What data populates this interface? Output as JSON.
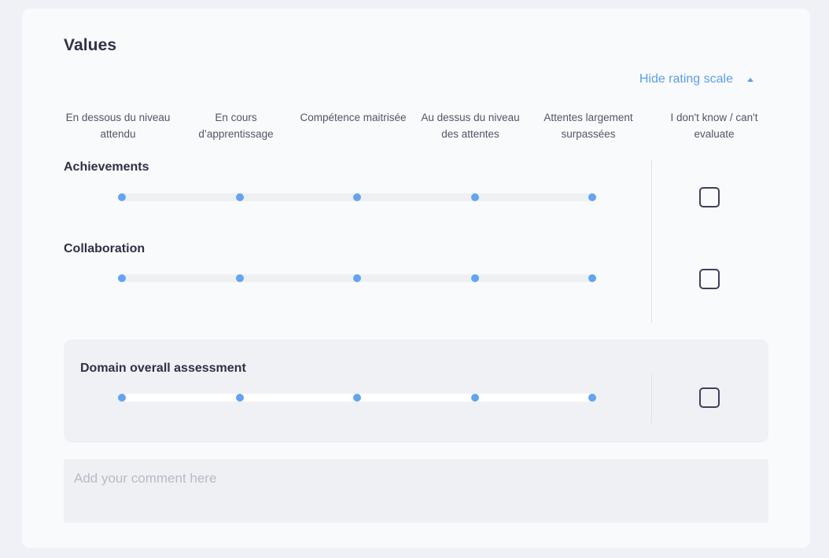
{
  "section": {
    "title": "Values",
    "toggle_label": "Hide rating scale"
  },
  "scale_labels": [
    "En dessous du niveau attendu",
    "En cours d’apprentissage",
    "Compétence maitrisée",
    "Au dessus du niveau des attentes",
    "Attentes largement surpassées",
    "I don't know / can't evaluate"
  ],
  "criteria": [
    {
      "label": "Achievements",
      "selected": null,
      "dont_know": false
    },
    {
      "label": "Collaboration",
      "selected": null,
      "dont_know": false
    }
  ],
  "overall": {
    "label": "Domain overall assessment",
    "selected": null,
    "dont_know": false
  },
  "comment": {
    "value": "",
    "placeholder": "Add your comment here"
  },
  "colors": {
    "accent": "#63a4ee",
    "link": "#5aa0e6",
    "text_dark": "#2f3048"
  }
}
